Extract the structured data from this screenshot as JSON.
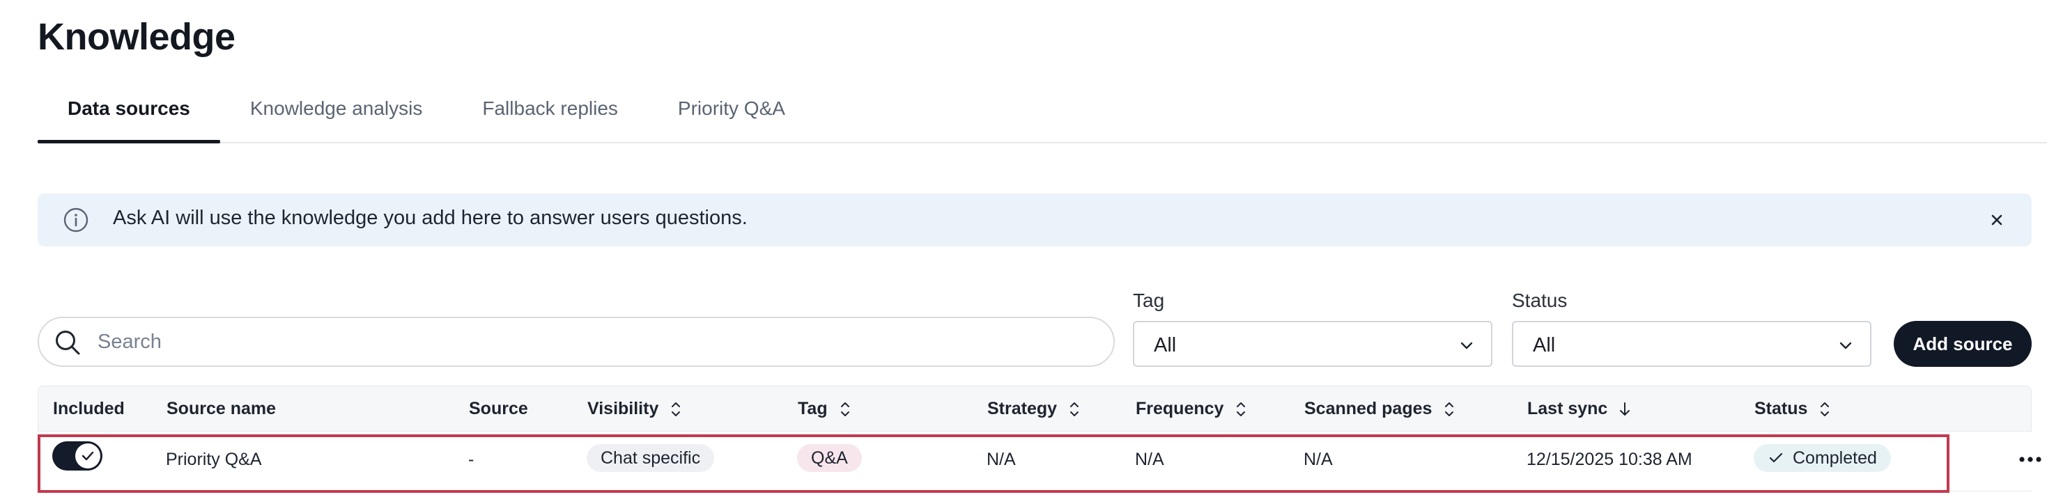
{
  "page": {
    "title": "Knowledge"
  },
  "tabs": [
    {
      "label": "Data sources",
      "active": true
    },
    {
      "label": "Knowledge analysis",
      "active": false
    },
    {
      "label": "Fallback replies",
      "active": false
    },
    {
      "label": "Priority Q&A",
      "active": false
    }
  ],
  "banner": {
    "icon": "info-icon",
    "text": "Ask AI will use the knowledge you add here to answer users questions.",
    "close_icon": "close-icon"
  },
  "search": {
    "placeholder": "Search",
    "value": ""
  },
  "filters": {
    "tag": {
      "label": "Tag",
      "value": "All"
    },
    "status": {
      "label": "Status",
      "value": "All"
    }
  },
  "add_source_label": "Add source",
  "table": {
    "columns": [
      {
        "label": "Included",
        "sortable": false
      },
      {
        "label": "Source name",
        "sortable": false
      },
      {
        "label": "Source",
        "sortable": false
      },
      {
        "label": "Visibility",
        "sortable": true
      },
      {
        "label": "Tag",
        "sortable": true
      },
      {
        "label": "Strategy",
        "sortable": true
      },
      {
        "label": "Frequency",
        "sortable": true
      },
      {
        "label": "Scanned pages",
        "sortable": true
      },
      {
        "label": "Last sync",
        "sortable": true,
        "sorted": "desc"
      },
      {
        "label": "Status",
        "sortable": true
      }
    ],
    "rows": [
      {
        "included": true,
        "source_name": "Priority Q&A",
        "source": "-",
        "visibility": "Chat specific",
        "tag": "Q&A",
        "strategy": "N/A",
        "frequency": "N/A",
        "scanned_pages": "N/A",
        "last_sync": "12/15/2025 10:38 AM",
        "status": "Completed"
      }
    ]
  },
  "colors": {
    "banner_bg": "#eaf3fa",
    "primary_dark": "#111826",
    "highlight_border": "#c23a4f",
    "tag_pill": "#f7e6ec",
    "status_pill": "#e6f2f4"
  }
}
